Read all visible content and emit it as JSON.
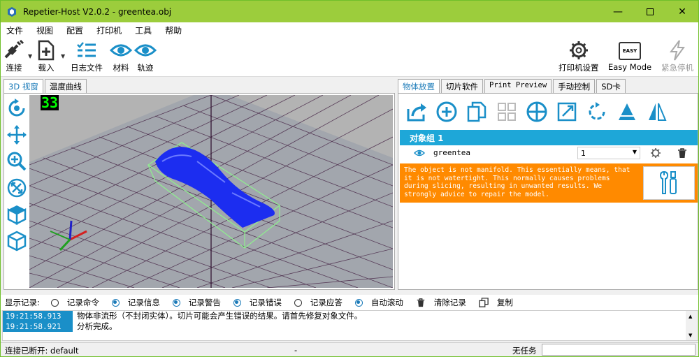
{
  "window": {
    "title": "Repetier-Host V2.0.2 - greentea.obj",
    "accent_color": "#9ccd3c"
  },
  "menu": [
    "文件",
    "视图",
    "配置",
    "打印机",
    "工具",
    "帮助"
  ],
  "toolbar": {
    "connect": "连接",
    "load": "载入",
    "log": "日志文件",
    "material": "材料",
    "path": "轨迹",
    "printer_settings": "打印机设置",
    "easy_mode": "Easy Mode",
    "easy_badge": "EASY",
    "emergency_stop": "紧急停机"
  },
  "left_tabs": [
    "3D 视窗",
    "温度曲线"
  ],
  "viewport": {
    "fps": "33"
  },
  "right_tabs": [
    "物体放置",
    "切片软件",
    "Print Preview",
    "手动控制",
    "SD卡"
  ],
  "objects": {
    "group_label": "对象组 1",
    "items": [
      {
        "name": "greentea",
        "copies": "1"
      }
    ]
  },
  "warning": {
    "text": "The object is not manifold. This essentially means, that it is not watertight. This normally causes problems during slicing, resulting in unwanted results. We strongly advice to repair the model.",
    "color": "#ff8a00"
  },
  "log": {
    "label": "显示记录:",
    "options": [
      {
        "label": "记录命令",
        "checked": false
      },
      {
        "label": "记录信息",
        "checked": true
      },
      {
        "label": "记录警告",
        "checked": true
      },
      {
        "label": "记录错误",
        "checked": true
      },
      {
        "label": "记录应答",
        "checked": false
      },
      {
        "label": "自动滚动",
        "checked": true
      }
    ],
    "clear": "清除记录",
    "copy": "复制",
    "entries": [
      {
        "time": "19:21:58.913",
        "message": "物体非流形（不封闭实体）。切片可能会产生错误的结果。请首先修复对象文件。"
      },
      {
        "time": "19:21:58.921",
        "message": "分析完成。"
      }
    ]
  },
  "status": {
    "connection": "连接已断开: default",
    "middle": "-",
    "task": "无任务"
  }
}
